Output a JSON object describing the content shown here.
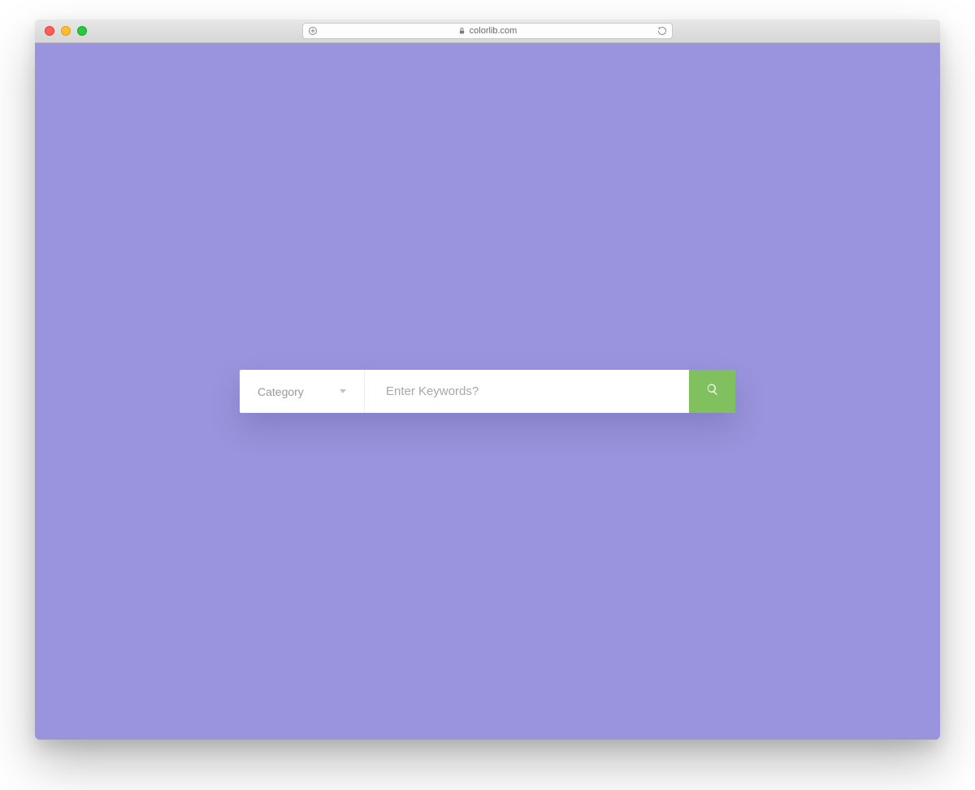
{
  "browser": {
    "domain": "colorlib.com"
  },
  "search": {
    "category_label": "Category",
    "keywords_placeholder": "Enter Keywords?",
    "keywords_value": ""
  },
  "colors": {
    "page_bg": "#9994dd",
    "button_bg": "#80c05e"
  }
}
